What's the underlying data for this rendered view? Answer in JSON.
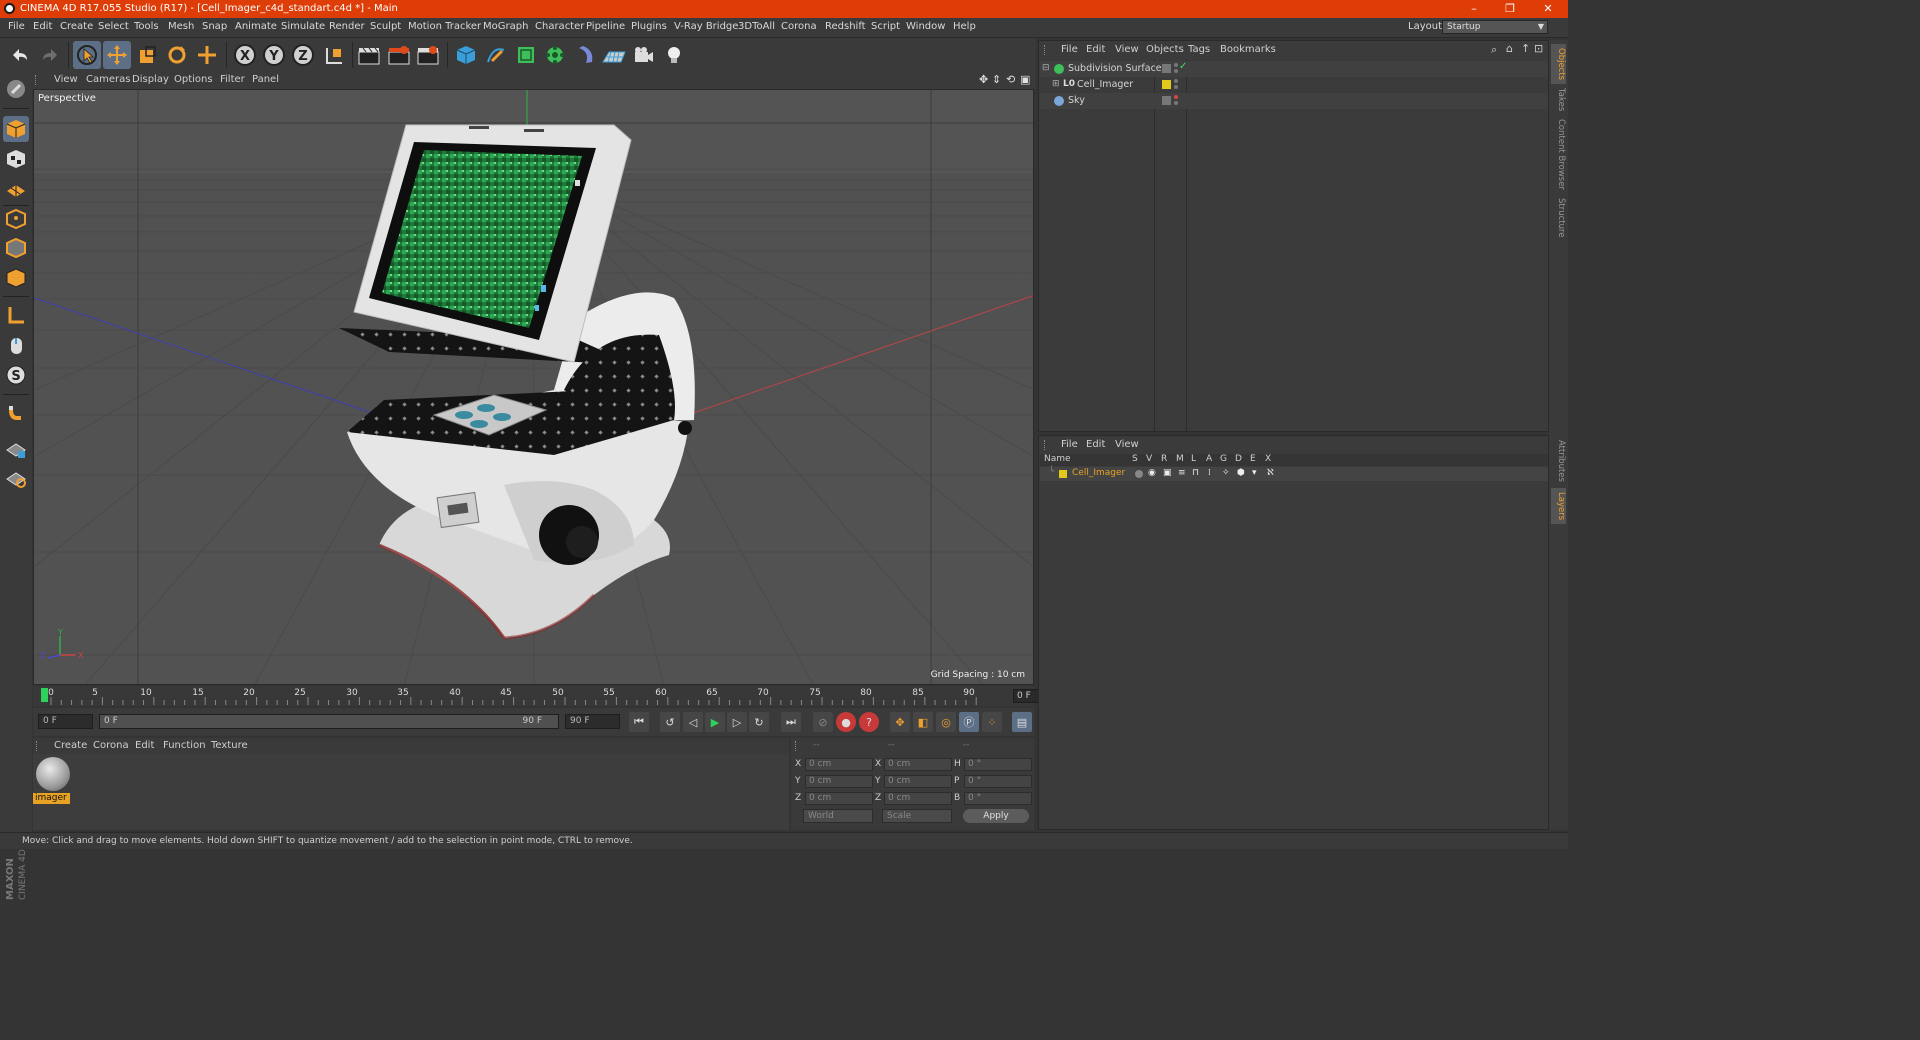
{
  "window": {
    "title": "CINEMA 4D R17.055 Studio (R17) - [Cell_Imager_c4d_standart.c4d *] - Main",
    "minimize": "–",
    "restore": "❐",
    "close": "✕"
  },
  "menubar": {
    "items": [
      "File",
      "Edit",
      "Create",
      "Select",
      "Tools",
      "Mesh",
      "Snap",
      "Animate",
      "Simulate",
      "Render",
      "Sculpt",
      "Motion Tracker",
      "MoGraph",
      "Character",
      "Pipeline",
      "Plugins",
      "V-Ray Bridge",
      "3DToAll",
      "Corona",
      "Redshift",
      "Script",
      "Window",
      "Help"
    ],
    "layout_label": "Layout:",
    "layout_value": "Startup"
  },
  "viewport": {
    "menus": [
      "View",
      "Cameras",
      "Display",
      "Options",
      "Filter",
      "Panel"
    ],
    "camera_label": "Perspective",
    "grid_spacing": "Grid Spacing : 10 cm"
  },
  "timeline": {
    "ticks": [
      "0",
      "5",
      "10",
      "15",
      "20",
      "25",
      "30",
      "35",
      "40",
      "45",
      "50",
      "55",
      "60",
      "65",
      "70",
      "75",
      "80",
      "85",
      "90"
    ],
    "current_frame": "0 F"
  },
  "transport": {
    "start_field": "0 F",
    "range_start": "0 F",
    "range_end": "90 F",
    "end_field": "90 F"
  },
  "material_manager": {
    "menus": [
      "Create",
      "Corona",
      "Edit",
      "Function",
      "Texture"
    ],
    "materials": [
      {
        "name": "imager"
      }
    ]
  },
  "coordinates": {
    "header": [
      "--",
      "--",
      "--"
    ],
    "rows": [
      {
        "axis": "X",
        "pos": "0 cm",
        "axis2": "X",
        "size": "0 cm",
        "rot_label": "H",
        "rot": "0 °"
      },
      {
        "axis": "Y",
        "pos": "0 cm",
        "axis2": "Y",
        "size": "0 cm",
        "rot_label": "P",
        "rot": "0 °"
      },
      {
        "axis": "Z",
        "pos": "0 cm",
        "axis2": "Z",
        "size": "0 cm",
        "rot_label": "B",
        "rot": "0 °"
      }
    ],
    "space": "World",
    "mode": "Scale",
    "apply": "Apply"
  },
  "object_manager": {
    "menus": [
      "File",
      "Edit",
      "View",
      "Objects",
      "Tags",
      "Bookmarks"
    ],
    "objects": [
      {
        "name": "Subdivision Surface",
        "icon_color": "#3fbf5a"
      },
      {
        "name": "Cell_Imager",
        "icon_color": "#d8d8d8"
      },
      {
        "name": "Sky",
        "icon_color": "#7aa6d8"
      }
    ]
  },
  "layer_manager": {
    "menus": [
      "File",
      "Edit",
      "View"
    ],
    "columns": [
      "Name",
      "S",
      "V",
      "R",
      "M",
      "L",
      "A",
      "G",
      "D",
      "E",
      "X"
    ],
    "layers": [
      {
        "name": "Cell_Imager",
        "color": "#e0c81c"
      }
    ]
  },
  "right_tabs": [
    "Objects",
    "Takes",
    "Content Browser",
    "Structure",
    "Attributes",
    "Layers"
  ],
  "status": "Move: Click and drag to move elements. Hold down SHIFT to quantize movement / add to the selection in point mode, CTRL to remove.",
  "colors": {
    "title_bar": "#de3d07",
    "selected_tool": "#5d6f86",
    "accent_orange": "#e8a324",
    "timeline_marker": "#2fd15a"
  }
}
